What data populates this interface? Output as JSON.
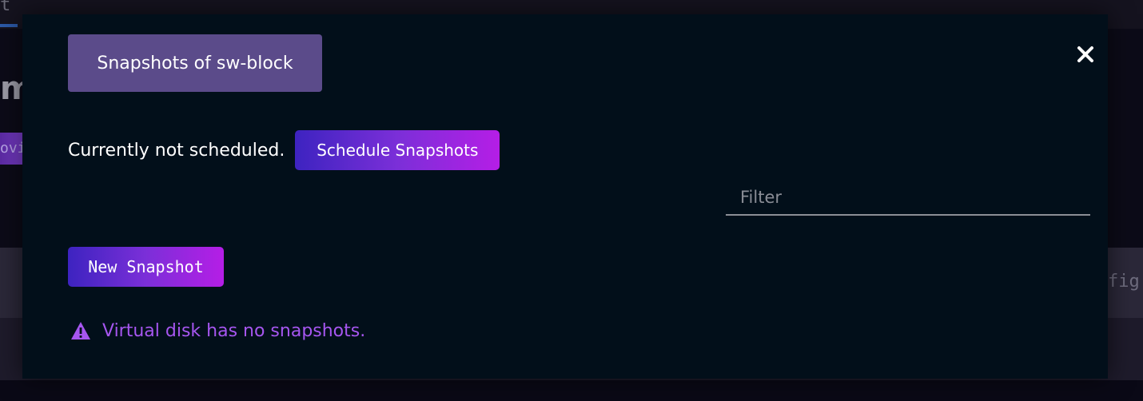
{
  "background": {
    "top_char": "t",
    "heading_fragment": "m",
    "badge_fragment": "ovis",
    "right_fragment": "fig"
  },
  "modal": {
    "title": "Snapshots of sw-block",
    "close_icon": "close-icon",
    "schedule": {
      "status_text": "Currently not scheduled.",
      "button_label": "Schedule Snapshots"
    },
    "filter": {
      "placeholder": "Filter",
      "value": ""
    },
    "new_snapshot_label": "New Snapshot",
    "empty_message": "Virtual disk has no snapshots.",
    "warning_icon": "warning-icon"
  },
  "colors": {
    "modal_bg": "#020f1a",
    "title_pill": "#5b4b8a",
    "button_gradient_start": "#3d23c0",
    "button_gradient_end": "#b51ee6",
    "warning": "#a656f0"
  }
}
